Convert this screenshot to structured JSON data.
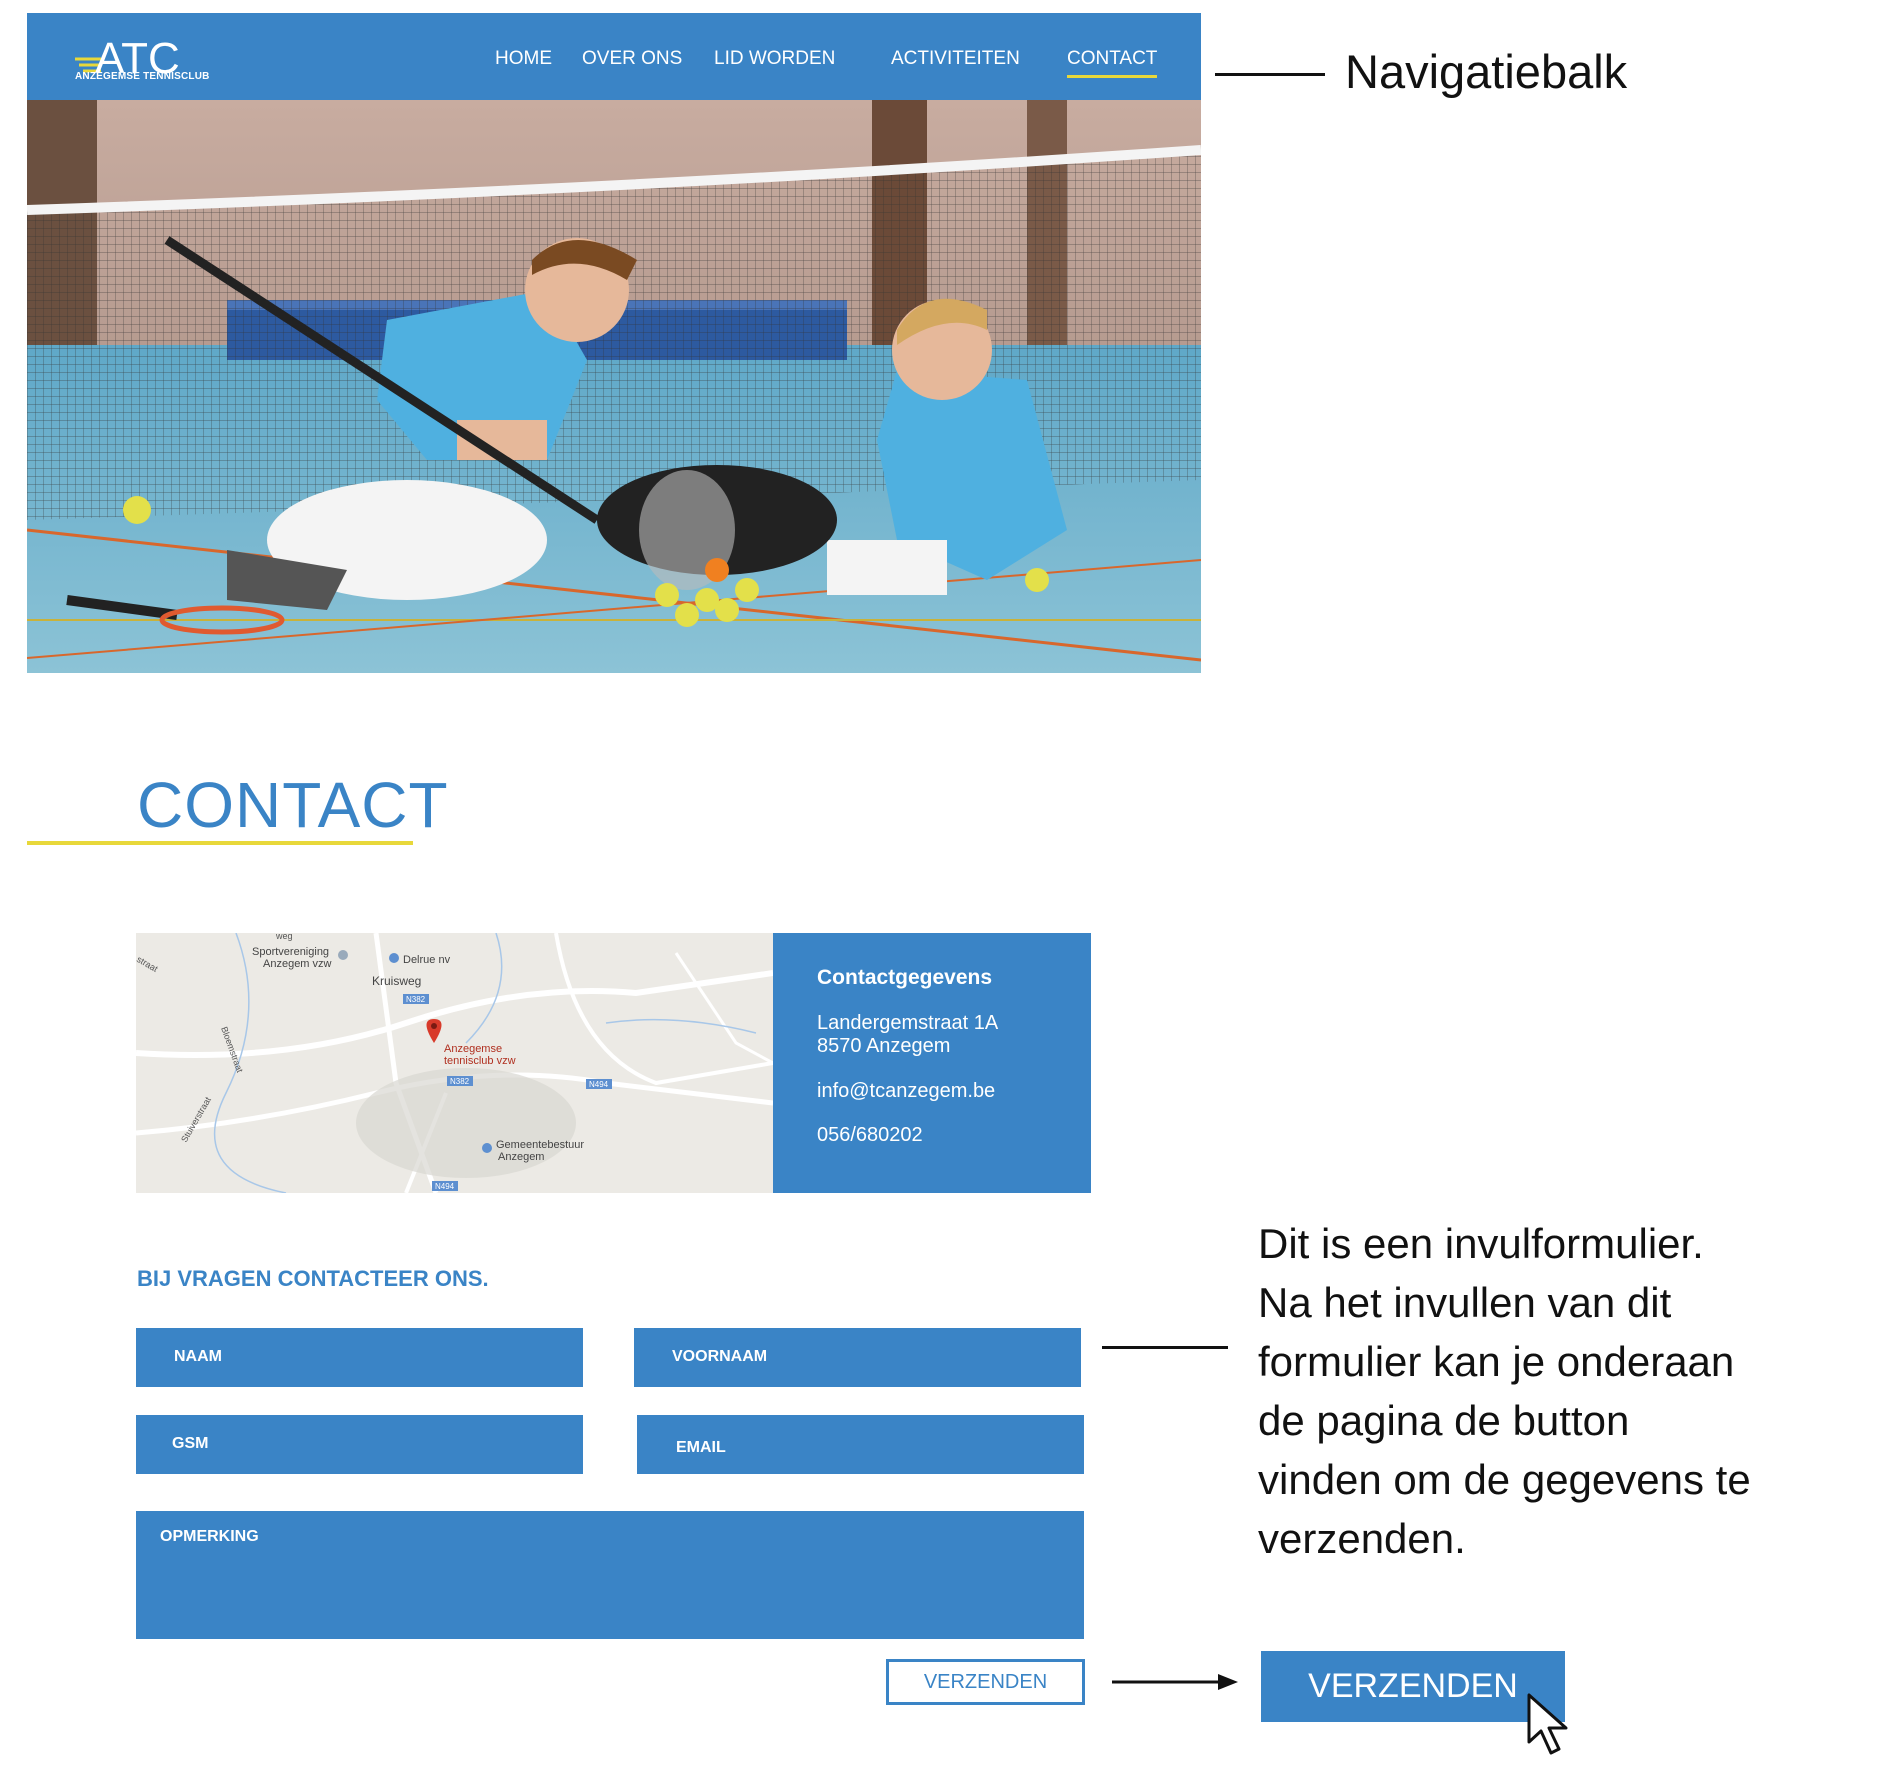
{
  "nav": {
    "logo_mark": "ATC",
    "logo_text": "ANZEGEMSE TENNISCLUB",
    "items": [
      {
        "label": "HOME"
      },
      {
        "label": "OVER ONS"
      },
      {
        "label": "LID WORDEN"
      },
      {
        "label": "ACTIVITEITEN"
      },
      {
        "label": "CONTACT",
        "active": true
      }
    ]
  },
  "hero": {
    "alt": "Two boys in blue shirts collecting tennis balls next to a net in an indoor sports hall"
  },
  "contact": {
    "title": "CONTACT",
    "map": {
      "labels": {
        "sportvereniging": "Sportvereniging",
        "anzegem_vzw": "Anzegem vzw",
        "delrue": "Delrue nv",
        "kruisweg": "Kruisweg",
        "n382a": "N382",
        "club1": "Anzegemse",
        "club2": "tennisclub vzw",
        "n382b": "N382",
        "n494a": "N494",
        "gemeente1": "Gemeentebestuur",
        "gemeente2": "Anzegem",
        "n494b": "N494",
        "bloemstraat": "Bloemstraat",
        "stuiverstraat": "Stuiverstraat",
        "straat": "straat",
        "weg": "weg"
      }
    },
    "info": {
      "title": "Contactgegevens",
      "street": "Landergemstraat 1A",
      "city": "8570 Anzegem",
      "email": "info@tcanzegem.be",
      "phone": "056/680202"
    }
  },
  "form": {
    "heading": "BIJ VRAGEN CONTACTEER ONS.",
    "naam": "NAAM",
    "voornaam": "VOORNAAM",
    "gsm": "GSM",
    "email": "EMAIL",
    "opmerking": "OPMERKING",
    "submit": "VERZENDEN"
  },
  "annotations": {
    "navbar": "Navigatiebalk",
    "form_lines": [
      "Dit is een invulformulier.",
      "Na het invullen van dit",
      "formulier kan je onderaan",
      "de pagina de button",
      "vinden om de gegevens te",
      "verzenden."
    ],
    "big_button": "VERZENDEN"
  },
  "colors": {
    "primary": "#3a84c6",
    "accent": "#e8d83a"
  }
}
